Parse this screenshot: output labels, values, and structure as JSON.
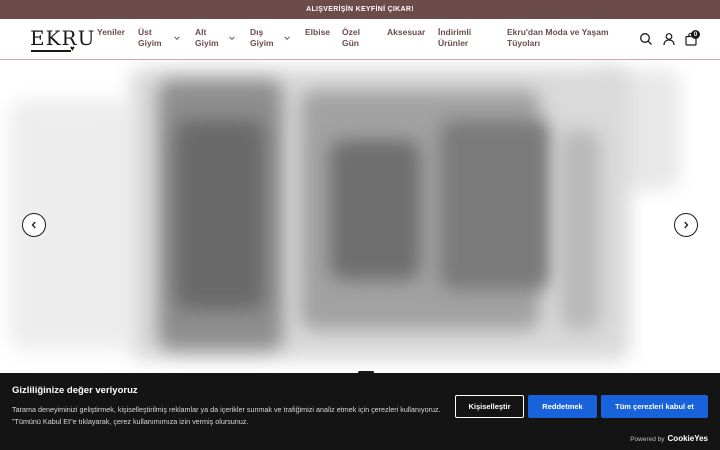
{
  "announcement": {
    "text": "ALIŞVERİŞİN KEYFİNİ ÇIKAR!"
  },
  "brand": {
    "logo_text": "EKRU",
    "color": "#6b4c4a"
  },
  "nav": {
    "items": [
      {
        "line1": "Yeniler",
        "line2": ""
      },
      {
        "line1": "Üst",
        "line2": "Giyim"
      },
      {
        "line1": "Alt",
        "line2": "Giyim"
      },
      {
        "line1": "Dış",
        "line2": "Giyim"
      },
      {
        "line1": "Elbise",
        "line2": ""
      },
      {
        "line1": "Özel",
        "line2": "Gün"
      },
      {
        "line1": "Aksesuar",
        "line2": ""
      },
      {
        "line1": "İndirimli",
        "line2": "Ürünler"
      },
      {
        "line1": "Ekru'dan Moda ve Yaşam",
        "line2": "Tüyoları"
      }
    ]
  },
  "header_icons": {
    "search": "search-icon",
    "account": "user-icon",
    "cart": "bag-icon",
    "cart_count": "0"
  },
  "slider": {
    "prev": "chevron-left-icon",
    "next": "chevron-right-icon",
    "slides_total": 1,
    "active_slide": 1
  },
  "cookie_banner": {
    "title": "Gizliliğinize değer veriyoruz",
    "text": "Tarama deneyiminizi geliştirmek, kişiselleştirilmiş reklamlar ya da içerikler sunmak ve trafiğimizi analiz etmek için çerezleri kullanıyoruz. \"Tümünü Kabul Et\"e tıklayarak, çerez kullanımımıza izin vermiş olursunuz.",
    "customize_label": "Kişiselleştir",
    "reject_label": "Reddetmek",
    "accept_label": "Tüm çerezleri kabul et",
    "powered_by": "Powered by",
    "powered_brand": "CookieYes",
    "accent_color": "#1863dc"
  }
}
